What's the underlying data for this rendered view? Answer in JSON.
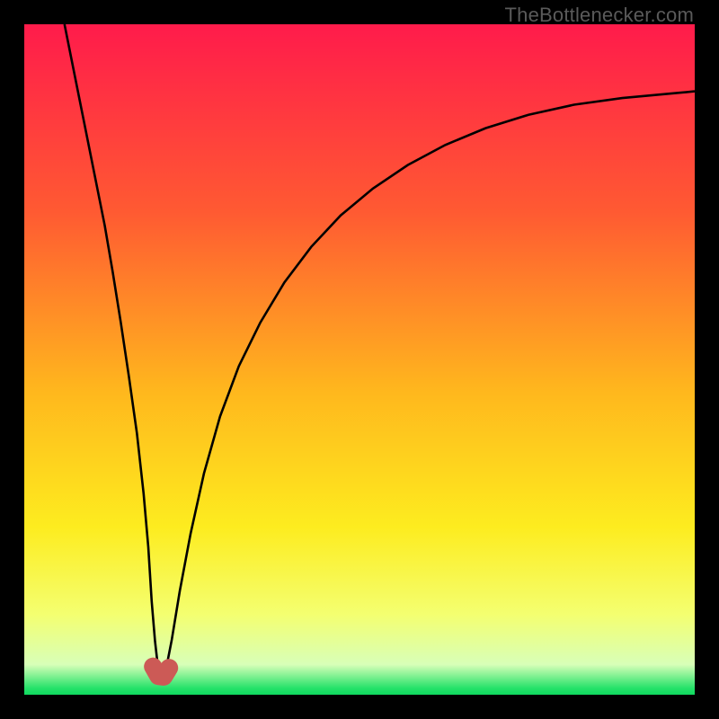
{
  "watermark": "TheBottlenecker.com",
  "chart_data": {
    "type": "line",
    "title": "",
    "xlabel": "",
    "ylabel": "",
    "xlim": [
      0,
      100
    ],
    "ylim": [
      0,
      100
    ],
    "gradient_stops": [
      {
        "offset": 0,
        "color": "#ff1b4b"
      },
      {
        "offset": 0.28,
        "color": "#ff5a32"
      },
      {
        "offset": 0.55,
        "color": "#ffb81d"
      },
      {
        "offset": 0.75,
        "color": "#fdec1f"
      },
      {
        "offset": 0.88,
        "color": "#f4ff70"
      },
      {
        "offset": 0.955,
        "color": "#d8ffb8"
      },
      {
        "offset": 0.99,
        "color": "#26e26a"
      },
      {
        "offset": 1.0,
        "color": "#0fd95f"
      }
    ],
    "series": [
      {
        "name": "bottleneck-curve",
        "color": "#000000",
        "x": [
          6.0,
          7.5,
          9.0,
          10.5,
          12.0,
          13.2,
          14.4,
          15.6,
          16.8,
          17.8,
          18.5,
          19.0,
          19.5,
          19.9,
          20.3,
          20.8,
          21.3,
          22.0,
          23.2,
          24.8,
          26.8,
          29.2,
          32.0,
          35.2,
          38.8,
          42.8,
          47.2,
          52.0,
          57.2,
          62.8,
          68.8,
          75.2,
          82.0,
          89.2,
          96.8,
          100.0
        ],
        "y": [
          100.0,
          92.5,
          85.0,
          77.5,
          70.0,
          63.0,
          55.5,
          47.5,
          39.0,
          30.0,
          22.0,
          14.0,
          8.0,
          4.5,
          3.2,
          3.2,
          4.6,
          8.2,
          15.5,
          24.0,
          33.0,
          41.5,
          49.0,
          55.5,
          61.5,
          66.8,
          71.5,
          75.5,
          79.0,
          82.0,
          84.5,
          86.5,
          88.0,
          89.0,
          89.7,
          90.0
        ]
      }
    ],
    "marker": {
      "name": "bottleneck-minimum-marker",
      "color": "#cc5a56",
      "points": [
        {
          "x": 19.2,
          "y": 4.2
        },
        {
          "x": 20.0,
          "y": 2.8
        },
        {
          "x": 20.8,
          "y": 2.7
        },
        {
          "x": 21.6,
          "y": 4.0
        }
      ],
      "stroke_width_pct": 2.7
    }
  }
}
